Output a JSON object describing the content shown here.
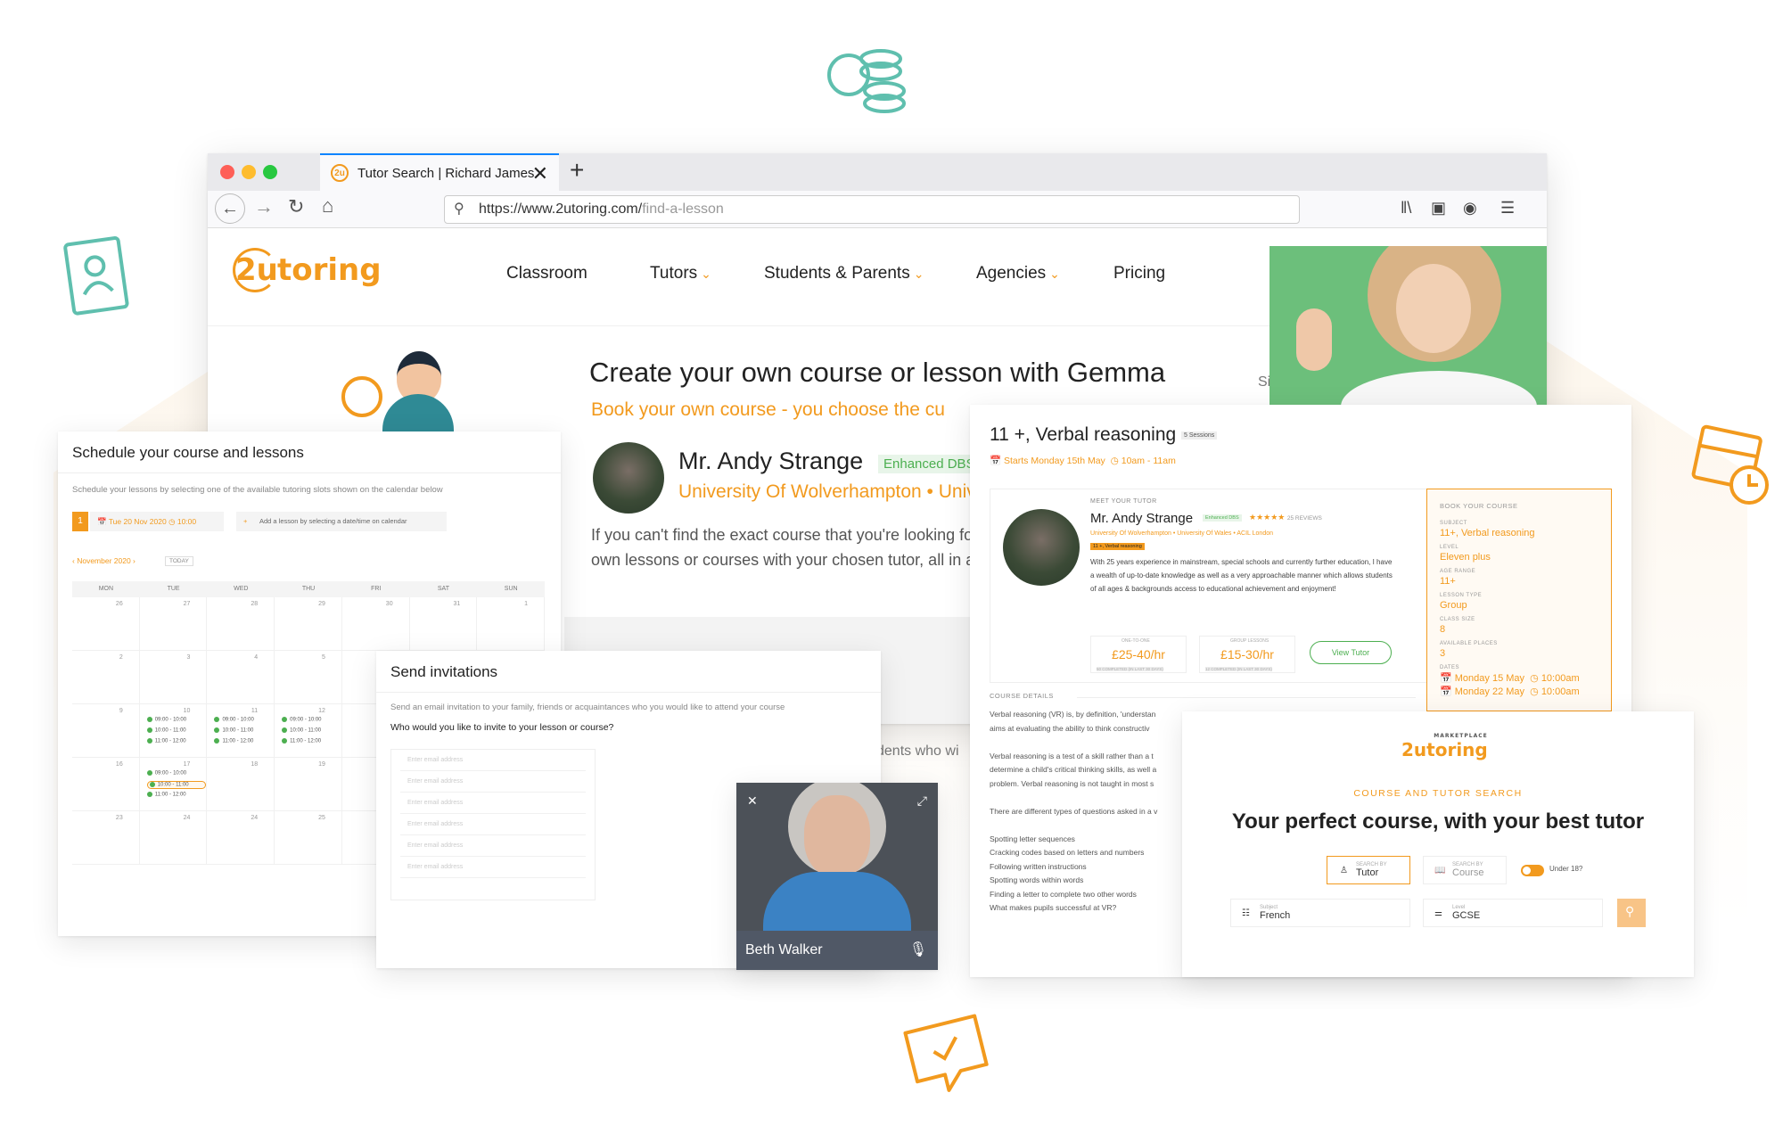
{
  "browser": {
    "tab_title": "Tutor Search | Richard James",
    "tab_favicon": "2u",
    "url_base": "https://www.2utoring.com/",
    "url_path": "find-a-lesson"
  },
  "site": {
    "logo_prefix": "2u",
    "logo_suffix": "toring",
    "nav": [
      {
        "label": "Classroom",
        "dropdown": false
      },
      {
        "label": "Tutors",
        "dropdown": true
      },
      {
        "label": "Students & Parents",
        "dropdown": true
      },
      {
        "label": "Agencies",
        "dropdown": true
      },
      {
        "label": "Pricing",
        "dropdown": false
      }
    ],
    "hero_title": "Create your own course or lesson with Gemma",
    "hero_subtitle": "Book your own course - you choose the cu",
    "tutor_name": "Mr. Andy Strange",
    "tutor_badge": "Enhanced DBS",
    "tutor_unis": "University Of Wolverhampton • Univ",
    "paragraph_line1": "If you can't find the exact course that you're looking fo",
    "paragraph_line2": "own lessons or courses with your chosen tutor, all in a",
    "cutoff_si": "Si",
    "cutoff_students": "dents who wi"
  },
  "schedule": {
    "title": "Schedule your course and lessons",
    "desc": "Schedule your lessons by selecting one of the available tutoring slots shown on the calendar below",
    "step": "1",
    "date": "Tue 20 Nov 2020",
    "time": "10:00",
    "add_hint": "Add a lesson by selecting a date/time on calendar",
    "month": "November 2020",
    "today": "TODAY",
    "days": [
      "MON",
      "TUE",
      "WED",
      "THU",
      "FRI",
      "SAT",
      "SUN"
    ],
    "weeks": [
      [
        "26",
        "27",
        "28",
        "29",
        "30",
        "31",
        "1"
      ],
      [
        "2",
        "3",
        "4",
        "5",
        "6",
        "7",
        "8"
      ],
      [
        "9",
        "10",
        "11",
        "12",
        "13",
        "14",
        "15"
      ],
      [
        "16",
        "17",
        "18",
        "19",
        "20",
        "21",
        "22"
      ],
      [
        "23",
        "24",
        "24",
        "25",
        "",
        "",
        ""
      ]
    ],
    "slots_a": [
      "09:00 - 10:00",
      "10:00 - 11:00",
      "11:00 - 12:00"
    ],
    "slot_selected": "10:00 - 11:00"
  },
  "invite": {
    "title": "Send invitations",
    "desc": "Send an email invitation to your family, friends or acquaintances who you would like to attend your course",
    "question": "Who would you like to invite to your lesson or course?",
    "placeholder": "Enter email address"
  },
  "video": {
    "name": "Beth Walker"
  },
  "course": {
    "title": "11 +, Verbal reasoning",
    "sessions": "5 Sessions",
    "starts": "Starts Monday 15th May",
    "time": "10am - 11am",
    "meet_label": "MEET YOUR TUTOR",
    "tutor": "Mr. Andy Strange",
    "dbs": "Enhanced DBS",
    "reviews": "25 REVIEWS",
    "unis": "University Of Wolverhampton • University Of Wales • ACIL London",
    "tag": "11 +, Verbal reasoning",
    "bio": "With 25 years experience in mainstream, special schools and currently further education, I have a wealth of up-to-date knowledge as well as a very approachable manner which allows students of all ages & backgrounds access to educational achievement and enjoyment!",
    "one_label": "ONE-TO-ONE",
    "one_price": "£25-40/hr",
    "one_note": "50 COMPLETED (IN LAST 30 DAYS)",
    "group_label": "GROUP LESSONS",
    "group_price": "£15-30/hr",
    "group_note": "12 COMPLETED (IN LAST 30 DAYS)",
    "view_btn": "View Tutor",
    "book_title": "BOOK YOUR COURSE",
    "book": [
      {
        "label": "SUBJECT",
        "value": "11+, Verbal reasoning"
      },
      {
        "label": "LEVEL",
        "value": "Eleven plus"
      },
      {
        "label": "AGE RANGE",
        "value": "11+"
      },
      {
        "label": "LESSON TYPE",
        "value": "Group"
      },
      {
        "label": "CLASS SIZE",
        "value": "8"
      },
      {
        "label": "AVAILABLE PLACES",
        "value": "3"
      }
    ],
    "dates_label": "DATES",
    "date1": "Monday 15 May",
    "date1_time": "10:00am",
    "date2": "Monday 22 May",
    "date2_time": "10:00am",
    "details_label": "COURSE DETAILS",
    "details": [
      "Verbal reasoning (VR) is, by definition, 'understan",
      "aims at evaluating the ability to think constructiv",
      "",
      "Verbal reasoning is a test of a skill rather than a t",
      "determine a child's critical thinking skills, as well a",
      "problem. Verbal reasoning is not taught in most s",
      "",
      "There are different types of questions asked in a v",
      "",
      "Spotting letter sequences",
      "Cracking codes based on letters and numbers",
      "Following written instructions",
      "Spotting words within words",
      "Finding a letter to complete two other words",
      "What makes pupils successful at VR?"
    ]
  },
  "search": {
    "logo_top": "MARKETPLACE",
    "logo": "2utoring",
    "kicker": "COURSE AND TUTOR SEARCH",
    "title": "Your perfect course, with your best tutor",
    "by_label": "SEARCH BY",
    "tutor": "Tutor",
    "course": "Course",
    "under18": "Under 18?",
    "subject_label": "Subject",
    "subject": "French",
    "level_label": "Level",
    "level": "GCSE"
  },
  "colors": {
    "accent": "#f29a1e",
    "green": "#4caf50",
    "deco": "#5fbfae"
  }
}
